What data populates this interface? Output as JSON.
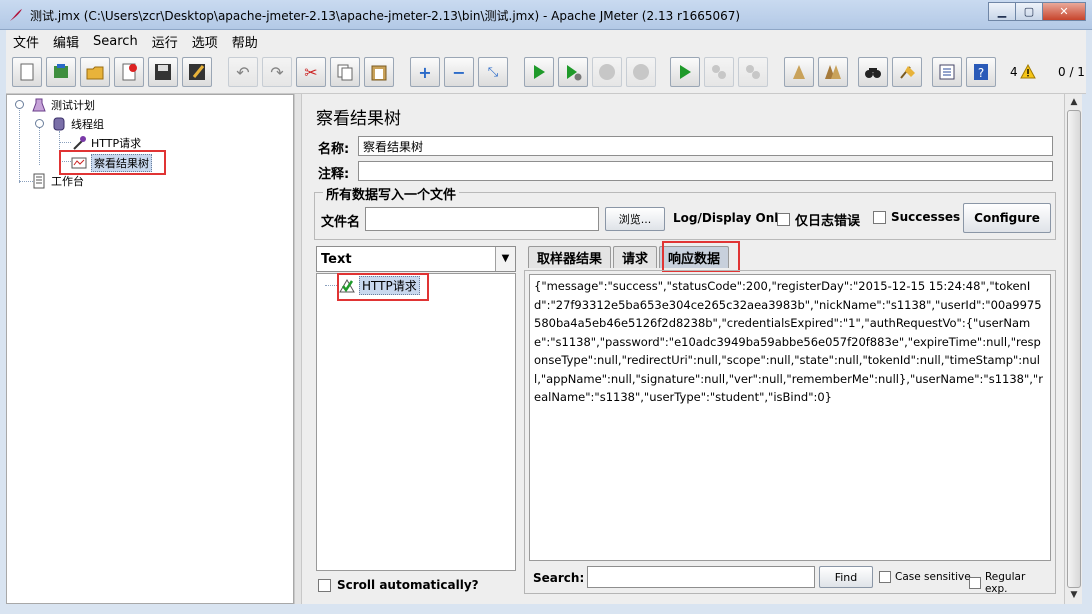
{
  "window": {
    "title": "测试.jmx (C:\\Users\\zcr\\Desktop\\apache-jmeter-2.13\\apache-jmeter-2.13\\bin\\测试.jmx) - Apache JMeter (2.13 r1665067)",
    "minimize": "▁",
    "maximize": "▢",
    "close": "✕"
  },
  "menu": [
    "文件",
    "编辑",
    "Search",
    "运行",
    "选项",
    "帮助"
  ],
  "toolbar": {
    "icons": [
      "new-icon",
      "templates-icon",
      "open-icon",
      "close-icon",
      "save-icon",
      "save-as-icon",
      "undo-icon",
      "redo-icon",
      "cut-icon",
      "copy-icon",
      "paste-icon",
      "expand-icon",
      "collapse-icon",
      "toggle-icon",
      "start-icon",
      "start-no-pause-icon",
      "stop-icon",
      "shutdown-icon",
      "remote-start-icon",
      "remote-stop-icon",
      "remote-shutdown-icon",
      "clear-icon",
      "clear-all-icon",
      "search-icon",
      "reset-search-icon",
      "function-helper-icon",
      "help-icon"
    ],
    "warning_count": "4",
    "threads": "0 / 1"
  },
  "tree": {
    "test_plan": "测试计划",
    "thread_group": "线程组",
    "http_request": "HTTP请求",
    "view_results_tree": "察看结果树",
    "workbench": "工作台"
  },
  "panel": {
    "title": "察看结果树",
    "name_label": "名称:",
    "name_value": "察看结果树",
    "comment_label": "注释:",
    "comment_value": "",
    "write_group_title": "所有数据写入一个文件",
    "filename_label": "文件名",
    "filename_value": "",
    "browse_label": "浏览...",
    "log_display_label": "Log/Display Only:",
    "errors_label": "仅日志错误",
    "successes_label": "Successes",
    "configure_label": "Configure"
  },
  "results": {
    "renderer": "Text",
    "samples": [
      "HTTP请求"
    ],
    "scroll_auto_label": "Scroll automatically?",
    "tabs": [
      "取样器结果",
      "请求",
      "响应数据"
    ],
    "active_tab": "响应数据",
    "response_body": "{\"message\":\"success\",\"statusCode\":200,\"registerDay\":\"2015-12-15 15:24:48\",\"tokenId\":\"27f93312e5ba653e304ce265c32aea3983b\",\"nickName\":\"s1138\",\"userId\":\"00a9975580ba4a5eb46e5126f2d8238b\",\"credentialsExpired\":\"1\",\"authRequestVo\":{\"userName\":\"s1138\",\"password\":\"e10adc3949ba59abbe56e057f20f883e\",\"expireTime\":null,\"responseType\":null,\"redirectUri\":null,\"scope\":null,\"state\":null,\"tokenId\":null,\"timeStamp\":null,\"appName\":null,\"signature\":null,\"ver\":null,\"rememberMe\":null},\"userName\":\"s1138\",\"realName\":\"s1138\",\"userType\":\"student\",\"isBind\":0}",
    "search_label": "Search:",
    "search_value": "",
    "find_label": "Find",
    "case_sensitive_label": "Case sensitive",
    "regex_label": "Regular exp."
  },
  "colors": {
    "highlight": "#e03434",
    "selection": "#c8d8ee"
  }
}
